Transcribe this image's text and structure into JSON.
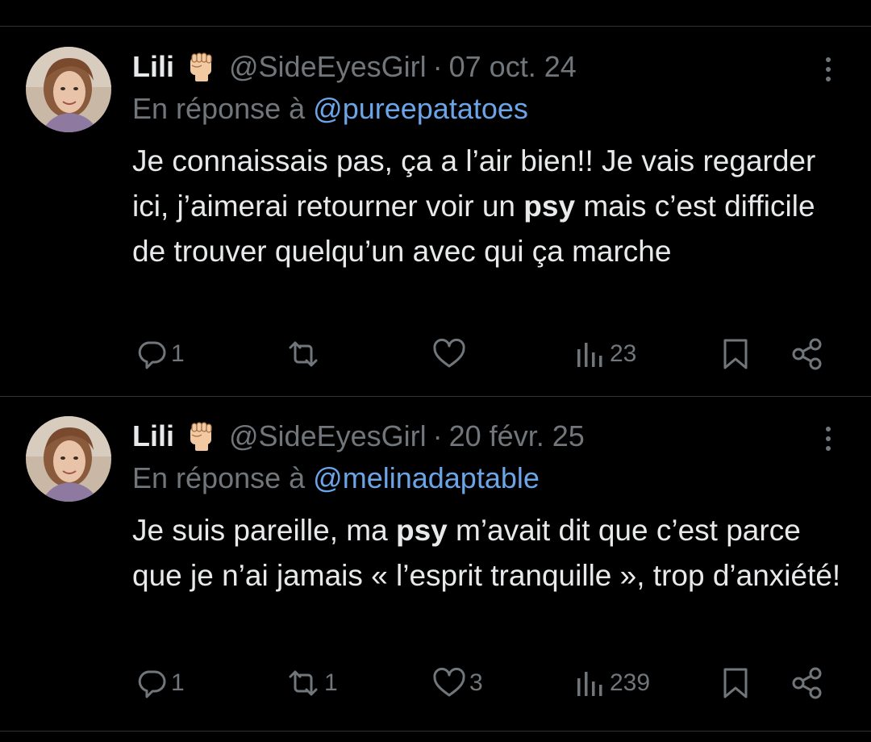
{
  "tweets": [
    {
      "name": "Lili",
      "emoji": "raised-fist-emoji",
      "handle": "@SideEyesGirl",
      "separator": "·",
      "date": "07 oct. 24",
      "reply_prefix": "En réponse à",
      "reply_to": "@pureepatatoes",
      "text_before": "Je connaissais pas, ça a l’air bien!! Je vais regarder ici, j’aimerai retourner voir un ",
      "text_bold": "psy",
      "text_after": " mais c’est difficile de trouver quelqu’un avec qui ça marche",
      "actions": {
        "replies": "1",
        "reposts": "",
        "likes": "",
        "views": "23"
      }
    },
    {
      "name": "Lili",
      "emoji": "raised-fist-emoji",
      "handle": "@SideEyesGirl",
      "separator": "·",
      "date": "20 févr. 25",
      "reply_prefix": "En réponse à",
      "reply_to": "@melinadaptable",
      "text_before": "Je suis pareille, ma ",
      "text_bold": "psy",
      "text_after": " m’avait dit que c’est parce que je n’ai jamais « l’esprit tranquille », trop d’anxiété!",
      "actions": {
        "replies": "1",
        "reposts": "1",
        "likes": "3",
        "views": "239"
      }
    }
  ],
  "colors": {
    "background": "#000000",
    "text": "#e7e9ea",
    "muted": "#71767b",
    "link": "#6ba5e8",
    "divider": "#2f3336"
  }
}
